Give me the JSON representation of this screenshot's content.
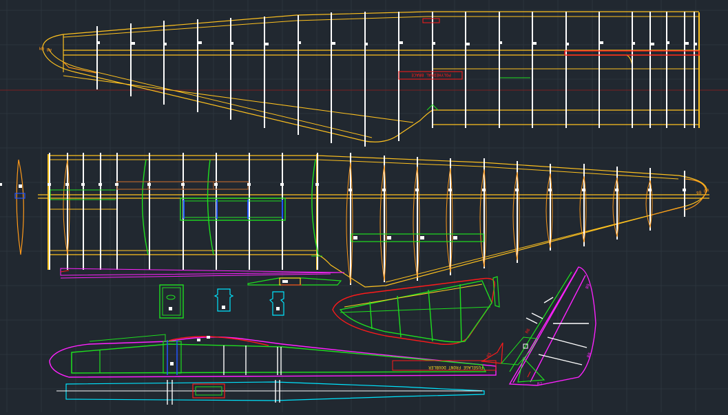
{
  "app": {
    "background": "#212830"
  },
  "colors": {
    "yellow": "#ffd21f",
    "orange": "#ff9a1a",
    "white": "#ffffff",
    "green": "#1fe01f",
    "red": "#ff1a1a",
    "magenta": "#ff22ff",
    "cyan": "#00e5ff",
    "blue": "#2255ff",
    "brown": "#b0602a",
    "grid_major": "#3a434e",
    "grid_minor": "#2b333c",
    "crosshair": "#8a2020"
  },
  "labels": {
    "wing_top_tip": "R8 GM",
    "wing_top_brace": "POLYHEDRAL BRACE",
    "wing_bottom_tip": "R8 GM",
    "fuselage": "FUSELAGE FRONT DOUBLER",
    "tail_a": "R9",
    "tail_b": "R8",
    "tail_c": "R7",
    "tail_d": "R6",
    "tail_e": "R5"
  }
}
